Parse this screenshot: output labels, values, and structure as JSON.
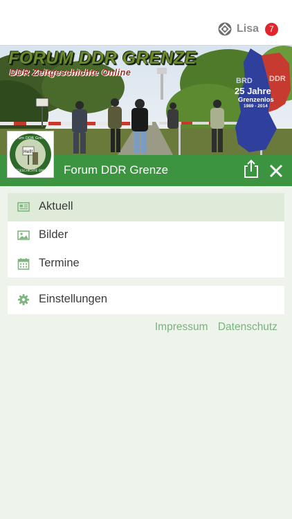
{
  "header": {
    "user_name": "Lisa",
    "notification_count": "7",
    "user_icon": "puzzle-network-icon"
  },
  "banner": {
    "title": "FORUM DDR GRENZE",
    "subtitle": "DDR Zeitgeschichte Online",
    "map_west": "BRD",
    "map_east": "DDR",
    "map_anniversary": "25 Jahre",
    "map_caption": "Grenzenlos",
    "map_years": "1989 - 2014",
    "logo_text": "Forum DDR Grenze",
    "logo_sign": "Hell!",
    "logo_bottom": "ZEITGESCHICHTE ONLINE"
  },
  "app_bar": {
    "title": "Forum DDR Grenze",
    "share_icon": "share-icon",
    "close_icon": "close-icon"
  },
  "menu": {
    "items": [
      {
        "label": "Aktuell",
        "icon": "newspaper-icon",
        "active": true
      },
      {
        "label": "Bilder",
        "icon": "image-icon",
        "active": false
      },
      {
        "label": "Termine",
        "icon": "calendar-icon",
        "active": false
      }
    ],
    "settings": {
      "label": "Einstellungen",
      "icon": "gear-icon"
    }
  },
  "footer": {
    "impressum": "Impressum",
    "datenschutz": "Datenschutz"
  },
  "colors": {
    "brand_green": "#3c9340",
    "active_item": "#deebd8",
    "link_green": "#79b27c",
    "badge_red": "#e0262c",
    "background": "#eef4ec"
  }
}
